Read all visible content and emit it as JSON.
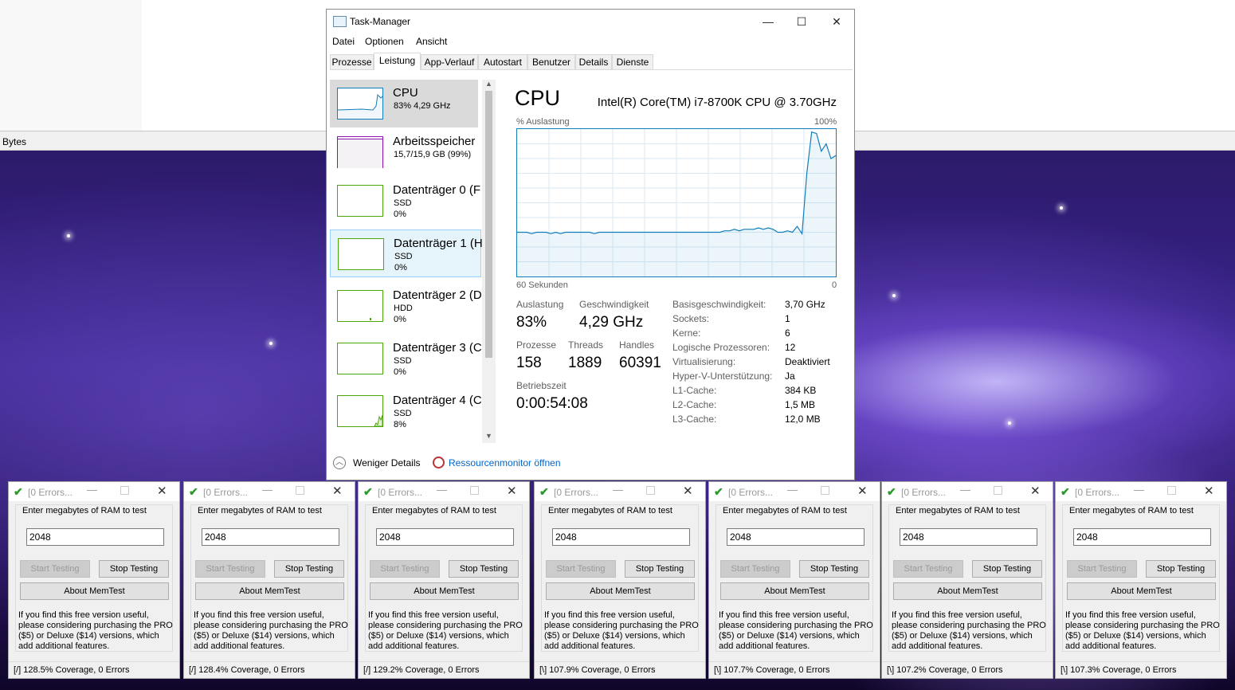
{
  "desktop": {
    "strip_label": "Bytes"
  },
  "taskmanager": {
    "title": "Task-Manager",
    "window_controls": {
      "minimize": "—",
      "maximize": "☐",
      "close": "✕"
    },
    "menu": [
      "Datei",
      "Optionen",
      "Ansicht"
    ],
    "tabs": [
      "Prozesse",
      "Leistung",
      "App-Verlauf",
      "Autostart",
      "Benutzer",
      "Details",
      "Dienste"
    ],
    "active_tab": "Leistung",
    "sidebar": [
      {
        "name": "CPU",
        "sub1": "83% 4,29 GHz",
        "sub2": "",
        "color": "#117dbb"
      },
      {
        "name": "Arbeitsspeicher",
        "sub1": "15,7/15,9 GB (99%)",
        "sub2": "",
        "color": "#8b12ae"
      },
      {
        "name": "Datenträger 0 (F",
        "sub1": "SSD",
        "sub2": "0%",
        "color": "#4da60c"
      },
      {
        "name": "Datenträger 1 (H",
        "sub1": "SSD",
        "sub2": "0%",
        "color": "#4da60c"
      },
      {
        "name": "Datenträger 2 (D",
        "sub1": "HDD",
        "sub2": "0%",
        "color": "#4da60c"
      },
      {
        "name": "Datenträger 3 (C",
        "sub1": "SSD",
        "sub2": "0%",
        "color": "#4da60c"
      },
      {
        "name": "Datenträger 4 (C",
        "sub1": "SSD",
        "sub2": "8%",
        "color": "#4da60c"
      }
    ],
    "main": {
      "title": "CPU",
      "model": "Intel(R) Core(TM) i7-8700K CPU @ 3.70GHz",
      "graph_label": "% Auslastung",
      "graph_max": "100%",
      "graph_time": "60 Sekunden",
      "graph_min": "0",
      "usage_series": [
        30,
        30,
        30,
        29,
        30,
        30,
        30,
        29,
        30,
        29,
        30,
        30,
        30,
        30,
        30,
        30,
        29,
        30,
        30,
        30,
        30,
        30,
        30,
        30,
        30,
        30,
        30,
        30,
        30,
        30,
        30,
        30,
        30,
        30,
        30,
        30,
        30,
        30,
        30,
        30,
        30,
        30,
        30,
        31,
        31,
        32,
        31,
        32,
        32,
        32,
        33,
        32,
        33,
        32,
        30,
        30,
        31,
        30,
        34,
        29,
        70,
        98,
        97,
        85,
        90,
        80,
        82
      ],
      "stats": {
        "auslastung_label": "Auslastung",
        "auslastung": "83%",
        "geschwindigkeit_label": "Geschwindigkeit",
        "geschwindigkeit": "4,29 GHz",
        "prozesse_label": "Prozesse",
        "prozesse": "158",
        "threads_label": "Threads",
        "threads": "1889",
        "handles_label": "Handles",
        "handles": "60391",
        "betriebszeit_label": "Betriebszeit",
        "betriebszeit": "0:00:54:08"
      },
      "details": [
        {
          "k": "Basisgeschwindigkeit:",
          "v": "3,70 GHz"
        },
        {
          "k": "Sockets:",
          "v": "1"
        },
        {
          "k": "Kerne:",
          "v": "6"
        },
        {
          "k": "Logische Prozessoren:",
          "v": "12"
        },
        {
          "k": "Virtualisierung:",
          "v": "Deaktiviert"
        },
        {
          "k": "Hyper-V-Unterstützung:",
          "v": "Ja"
        },
        {
          "k": "L1-Cache:",
          "v": "384 KB"
        },
        {
          "k": "L2-Cache:",
          "v": "1,5 MB"
        },
        {
          "k": "L3-Cache:",
          "v": "12,0 MB"
        }
      ]
    },
    "footer": {
      "fewer": "Weniger Details",
      "resmon": "Ressourcenmonitor öffnen"
    }
  },
  "memtest": {
    "title": "[0 Errors...",
    "prompt": "Enter megabytes of RAM to test",
    "start": "Start Testing",
    "stop": "Stop Testing",
    "about": "About MemTest",
    "promo": "If you find this free version useful, please considering purchasing the PRO ($5) or Deluxe ($14) versions, which add additional features.",
    "windows": [
      {
        "value": "2048",
        "status": "[/]   128.5% Coverage, 0 Errors"
      },
      {
        "value": "2048",
        "status": "[/]   128.4% Coverage, 0 Errors"
      },
      {
        "value": "2048",
        "status": "[/]   129.2% Coverage, 0 Errors"
      },
      {
        "value": "2048",
        "status": "[\\]   107.9% Coverage, 0 Errors"
      },
      {
        "value": "2048",
        "status": "[\\]   107.7% Coverage, 0 Errors"
      },
      {
        "value": "2048",
        "status": "[\\]   107.2% Coverage, 0 Errors"
      },
      {
        "value": "2048",
        "status": "[\\]   107.3% Coverage, 0 Errors"
      }
    ]
  }
}
